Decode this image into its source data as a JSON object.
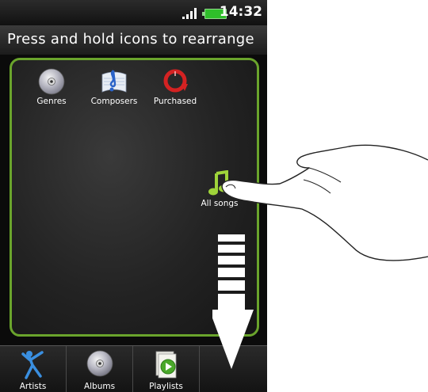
{
  "status_bar": {
    "time": "14:32"
  },
  "header": {
    "title": "Press and hold icons to rearrange"
  },
  "panel": {
    "items": [
      {
        "label": "Genres",
        "icon": "disc-icon"
      },
      {
        "label": "Composers",
        "icon": "music-score-icon"
      },
      {
        "label": "Purchased",
        "icon": "purchased-icon"
      },
      {
        "label": "All songs",
        "icon": "music-note-icon"
      }
    ]
  },
  "tabs": [
    {
      "label": "Artists",
      "icon": "artist-icon"
    },
    {
      "label": "Albums",
      "icon": "album-disc-icon"
    },
    {
      "label": "Playlists",
      "icon": "playlist-icon"
    },
    {
      "label": "",
      "icon": ""
    }
  ],
  "colors": {
    "accent": "#6aa42c",
    "background": "#0b0b0b"
  }
}
